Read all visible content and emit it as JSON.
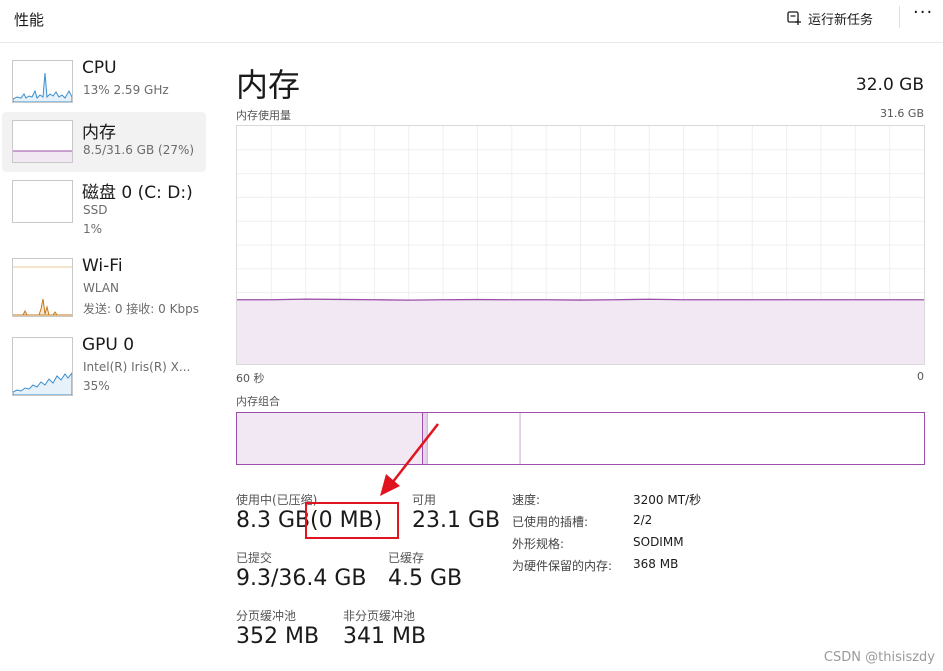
{
  "header": {
    "title": "性能",
    "run_task_label": "运行新任务",
    "more_label": "···"
  },
  "sidebar": {
    "items": [
      {
        "name": "CPU",
        "sub1": "13% 2.59 GHz",
        "sub2": "",
        "icon": "cpu-graph"
      },
      {
        "name": "内存",
        "sub1": "8.5/31.6 GB (27%)",
        "sub2": "",
        "icon": "memory-graph",
        "selected": true
      },
      {
        "name": "磁盘 0 (C: D:)",
        "sub1": "SSD",
        "sub2": "1%",
        "icon": "disk-graph"
      },
      {
        "name": "Wi-Fi",
        "sub1": "WLAN",
        "sub2": "发送: 0 接收: 0 Kbps",
        "icon": "wifi-graph"
      },
      {
        "name": "GPU 0",
        "sub1": "Intel(R) Iris(R) X...",
        "sub2": "35%",
        "icon": "gpu-graph"
      }
    ]
  },
  "main": {
    "title": "内存",
    "total": "32.0 GB",
    "graph": {
      "label": "内存使用量",
      "max_label": "31.6 GB",
      "time_left": "60 秒",
      "time_right": "0",
      "usage_fraction": 0.27
    },
    "composition": {
      "label": "内存组合",
      "in_use_fraction": 0.27,
      "modified_fraction": 0.007,
      "standby_fraction": 0.135
    },
    "stats": {
      "in_use_label": "使用中(已压缩)",
      "in_use_value": "8.3 GB",
      "compressed_value": "(0 MB)",
      "available_label": "可用",
      "available_value": "23.1 GB",
      "committed_label": "已提交",
      "committed_value": "9.3/36.4 GB",
      "cached_label": "已缓存",
      "cached_value": "4.5 GB",
      "paged_label": "分页缓冲池",
      "paged_value": "352 MB",
      "nonpaged_label": "非分页缓冲池",
      "nonpaged_value": "341 MB"
    },
    "details": [
      {
        "key": "速度:",
        "value": "3200 MT/秒"
      },
      {
        "key": "已使用的插槽:",
        "value": "2/2"
      },
      {
        "key": "外形规格:",
        "value": "SODIMM"
      },
      {
        "key": "为硬件保留的内存:",
        "value": "368 MB"
      }
    ]
  },
  "colors": {
    "memory_accent": "#9b4fa8",
    "memory_fill": "#f1e8f3",
    "cpu_accent": "#3b8fd0",
    "wifi_accent": "#c37a1a",
    "annotation_red": "#e0141e"
  },
  "watermark": "CSDN @thisiszdy"
}
